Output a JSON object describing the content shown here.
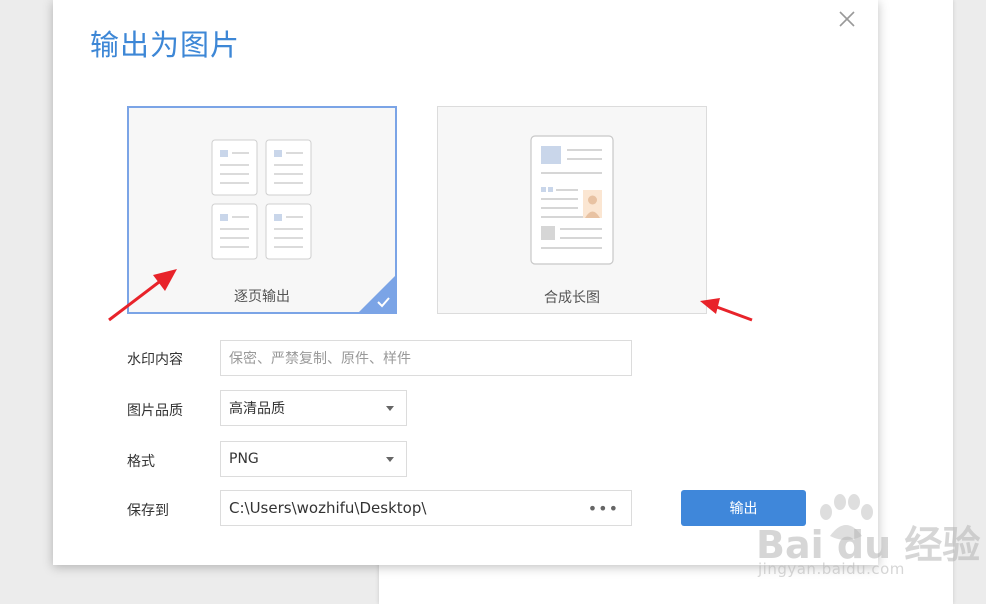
{
  "dialog": {
    "title": "输出为图片",
    "close_icon": "close-icon"
  },
  "modes": [
    {
      "label": "逐页输出",
      "selected": true,
      "icon": "multi-page-icon"
    },
    {
      "label": "合成长图",
      "selected": false,
      "icon": "long-image-icon"
    }
  ],
  "form": {
    "watermark_label": "水印内容",
    "watermark_placeholder": "保密、严禁复制、原件、样件",
    "quality_label": "图片品质",
    "quality_value": "高清品质",
    "format_label": "格式",
    "format_value": "PNG",
    "save_label": "保存到",
    "save_path": "C:\\Users\\wozhifu\\Desktop\\",
    "browse_dots": "•••"
  },
  "actions": {
    "export_label": "输出"
  },
  "watermark_overlay": {
    "logo_text": "Bai du 经验",
    "url": "jingyan.baidu.com"
  },
  "colors": {
    "accent": "#3f87da",
    "title": "#3d87d6",
    "selected_border": "#7ba4e6",
    "annotation_arrow": "#e8232a"
  }
}
